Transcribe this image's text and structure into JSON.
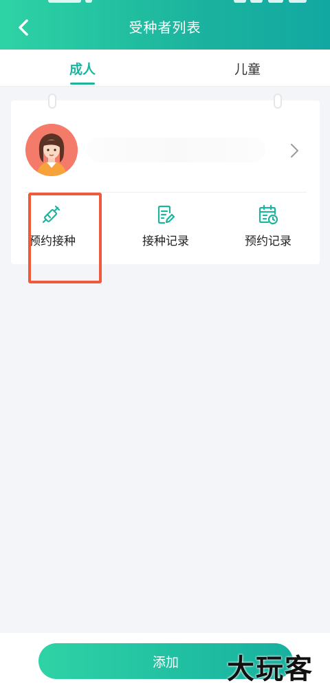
{
  "header": {
    "title": "受种者列表",
    "back_icon": "chevron-left-icon"
  },
  "tabs": [
    {
      "label": "成人",
      "active": true
    },
    {
      "label": "儿童",
      "active": false
    }
  ],
  "person": {
    "avatar": "female-avatar",
    "name": "",
    "chevron_icon": "chevron-right-icon"
  },
  "actions": [
    {
      "label": "预约接种",
      "icon": "syringe-icon"
    },
    {
      "label": "接种记录",
      "icon": "record-edit-icon"
    },
    {
      "label": "预约记录",
      "icon": "calendar-clock-icon"
    }
  ],
  "footer": {
    "add_label": "添加"
  },
  "watermark": "大玩客",
  "colors": {
    "accent": "#1cb49c",
    "highlight_box": "#f05a3c",
    "avatar_bg": "#f47a6a"
  }
}
